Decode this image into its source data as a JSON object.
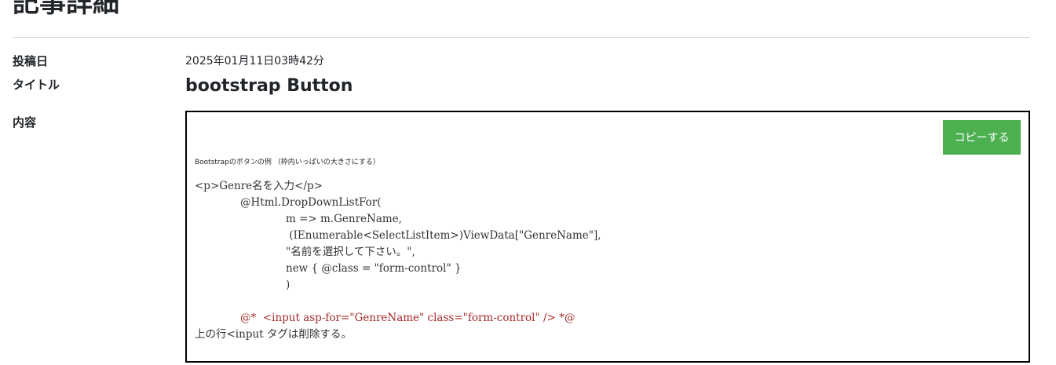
{
  "page_title": "記事詳細",
  "fields": {
    "date_label": "投稿日",
    "date_value": "2025年01月11日03時42分",
    "title_label": "タイトル",
    "title_value": "bootstrap Button",
    "content_label": "内容"
  },
  "content": {
    "copy_button_label": "コピーする",
    "small_heading": "Bootstrapのボタンの例 （枠内いっぱいの大きさにする）",
    "code_lines": [
      {
        "text": "<p>Genre名を入力</p>",
        "indent": 0,
        "type": "normal"
      },
      {
        "text": "@Html.DropDownListFor(",
        "indent": 1,
        "type": "normal"
      },
      {
        "text": "m => m.GenreName,",
        "indent": 2,
        "type": "normal"
      },
      {
        "text": " (IEnumerable<SelectListItem>)ViewData[\"GenreName\"],",
        "indent": 2,
        "type": "normal"
      },
      {
        "text": "\"名前を選択して下さい。\",",
        "indent": 2,
        "type": "normal"
      },
      {
        "text": "new { @class = \"form-control\" }",
        "indent": 2,
        "type": "normal"
      },
      {
        "text": ")",
        "indent": 2,
        "type": "normal"
      },
      {
        "text": "",
        "indent": 0,
        "type": "blank"
      },
      {
        "text": "@*  <input asp-for=\"GenreName\" class=\"form-control\" /> *@",
        "indent": 1,
        "type": "comment"
      },
      {
        "text": "上の行<input タグは削除する。",
        "indent": 0,
        "type": "normal"
      }
    ]
  },
  "colors": {
    "copy_button_bg": "#4caf50",
    "comment_text": "#a52a2a"
  }
}
